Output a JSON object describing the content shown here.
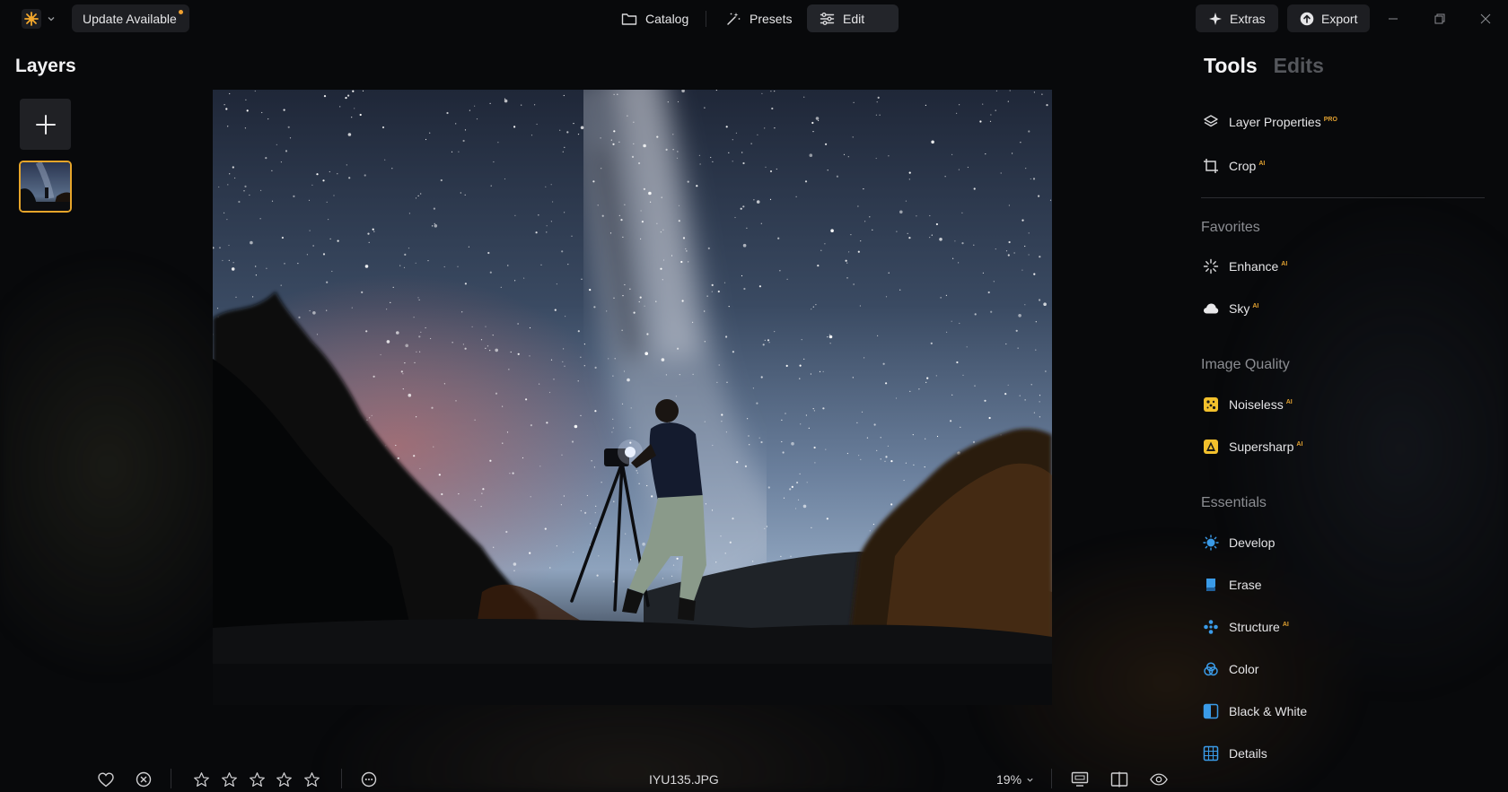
{
  "topbar": {
    "update_label": "Update Available",
    "catalog_label": "Catalog",
    "presets_label": "Presets",
    "edit_label": "Edit",
    "extras_label": "Extras",
    "export_label": "Export"
  },
  "layers": {
    "title": "Layers"
  },
  "photo": {
    "filename": "IYU135.JPG",
    "zoom": "19%"
  },
  "tabs": {
    "tools": "Tools",
    "edits": "Edits"
  },
  "tools": {
    "layer_properties": {
      "label": "Layer Properties",
      "badge": "PRO"
    },
    "crop": {
      "label": "Crop",
      "badge": "AI"
    }
  },
  "sections": {
    "favorites": {
      "title": "Favorites",
      "items": [
        {
          "label": "Enhance",
          "badge": "AI"
        },
        {
          "label": "Sky",
          "badge": "AI"
        }
      ]
    },
    "image_quality": {
      "title": "Image Quality",
      "items": [
        {
          "label": "Noiseless",
          "badge": "AI"
        },
        {
          "label": "Supersharp",
          "badge": "AI"
        }
      ]
    },
    "essentials": {
      "title": "Essentials",
      "items": [
        {
          "label": "Develop",
          "badge": ""
        },
        {
          "label": "Erase",
          "badge": ""
        },
        {
          "label": "Structure",
          "badge": "AI"
        },
        {
          "label": "Color",
          "badge": ""
        },
        {
          "label": "Black & White",
          "badge": ""
        },
        {
          "label": "Details",
          "badge": ""
        }
      ]
    }
  },
  "colors": {
    "accent": "#e6a52a",
    "blue_icon": "#3a9be8",
    "yellow_icon": "#f2c02c"
  }
}
